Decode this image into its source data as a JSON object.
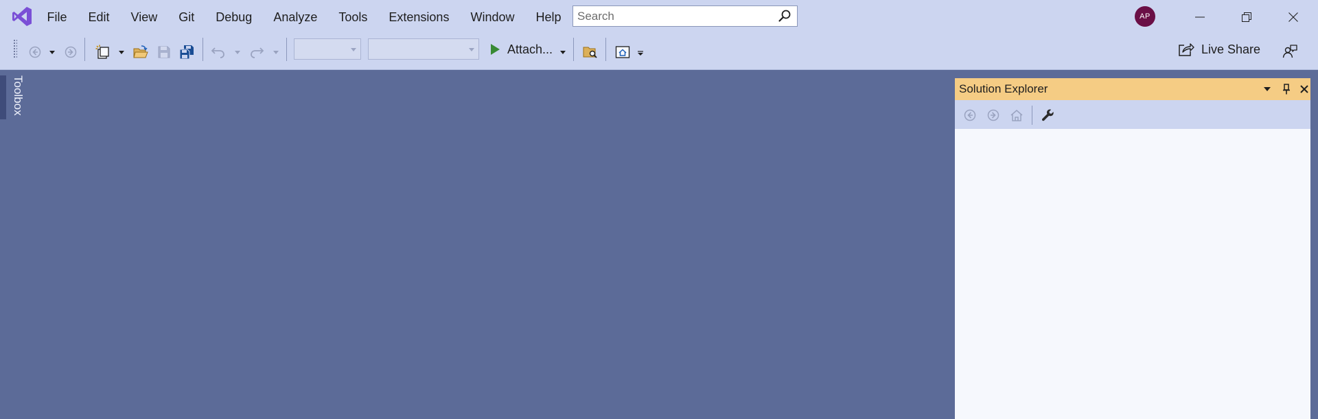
{
  "colors": {
    "chrome_bg": "#ccd5f0",
    "workspace_bg": "#5c6b98",
    "panel_header_bg": "#f5cc84",
    "panel_body_bg": "#f6f8fd",
    "avatar_bg": "#6a0f46",
    "brand": "#7a4fd6",
    "run_green": "#388a34"
  },
  "titlebar": {
    "menu": [
      "File",
      "Edit",
      "View",
      "Git",
      "Debug",
      "Analyze",
      "Tools",
      "Extensions",
      "Window",
      "Help"
    ],
    "search_placeholder": "Search",
    "avatar_initials": "AP",
    "window_controls": [
      "minimize-icon",
      "restore-icon",
      "close-icon"
    ]
  },
  "toolbar": {
    "attach_label": "Attach...",
    "live_share_label": "Live Share",
    "configuration_value": "",
    "platform_value": ""
  },
  "toolbox": {
    "label": "Toolbox"
  },
  "solution_explorer": {
    "title": "Solution Explorer",
    "toolbar_icons": [
      "back-icon",
      "forward-icon",
      "home-icon",
      "wrench-icon"
    ]
  }
}
